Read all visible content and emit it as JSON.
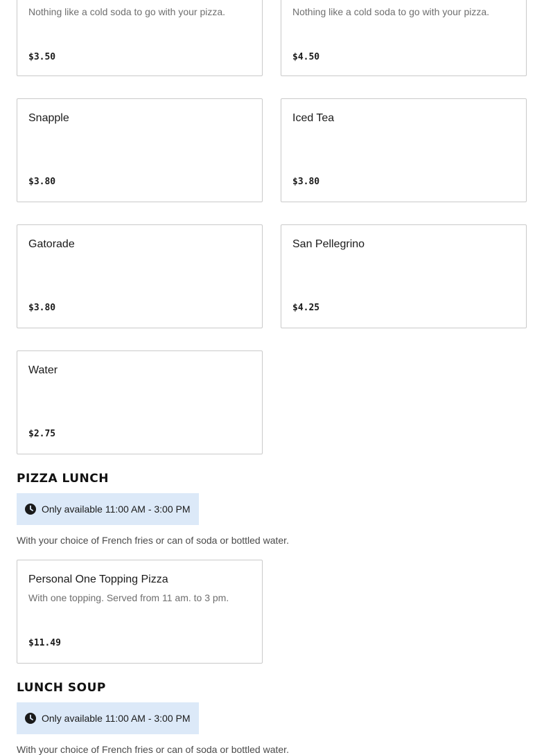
{
  "drinks": {
    "items": [
      {
        "name": "",
        "description": "Nothing like a cold soda to go with your pizza.",
        "price": "$3.50"
      },
      {
        "name": "",
        "description": "Nothing like a cold soda to go with your pizza.",
        "price": "$4.50"
      },
      {
        "name": "Snapple",
        "description": "",
        "price": "$3.80"
      },
      {
        "name": "Iced Tea",
        "description": "",
        "price": "$3.80"
      },
      {
        "name": "Gatorade",
        "description": "",
        "price": "$3.80"
      },
      {
        "name": "San Pellegrino",
        "description": "",
        "price": "$4.25"
      },
      {
        "name": "Water",
        "description": "",
        "price": "$2.75"
      }
    ]
  },
  "pizza_lunch": {
    "title": "PIZZA LUNCH",
    "availability": "Only available 11:00 AM - 3:00 PM",
    "description": "With your choice of French fries or can of soda or bottled water.",
    "items": [
      {
        "name": "Personal One Topping Pizza",
        "description": "With one topping. Served from 11 am. to 3 pm.",
        "price": "$11.49"
      }
    ]
  },
  "lunch_soup": {
    "title": "LUNCH SOUP",
    "availability": "Only available 11:00 AM - 3:00 PM",
    "description": "With your choice of French fries or can of soda or bottled water."
  },
  "icons": {
    "availability": "clock-icon"
  },
  "colors": {
    "availability_bg": "#dce9f8",
    "card_border": "#c9c9c9"
  }
}
